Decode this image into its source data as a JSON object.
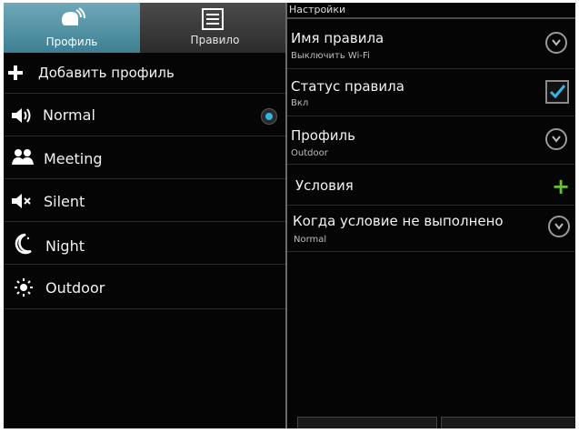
{
  "tabs": {
    "profile_label": "Профиль",
    "rule_label": "Правило"
  },
  "profiles": {
    "add_label": "Добавить профиль",
    "items": [
      {
        "label": "Normal",
        "icon": "speaker-icon",
        "selected": true
      },
      {
        "label": "Meeting",
        "icon": "people-icon",
        "selected": false
      },
      {
        "label": "Silent",
        "icon": "mute-icon",
        "selected": false
      },
      {
        "label": "Night",
        "icon": "moon-icon",
        "selected": false
      },
      {
        "label": "Outdoor",
        "icon": "sun-icon",
        "selected": false
      }
    ]
  },
  "settings": {
    "header": "Настройки",
    "rule_name": {
      "title": "Имя правила",
      "value": "Выключить Wi-Fi"
    },
    "rule_status": {
      "title": "Статус правила",
      "value": "Вкл",
      "checked": true
    },
    "profile": {
      "title": "Профиль",
      "value": "Outdoor"
    },
    "conditions": {
      "title": "Условия"
    },
    "otherwise": {
      "title": "Когда условие не выполнено",
      "value": "Normal"
    }
  },
  "colors": {
    "accent": "#33b5e5",
    "active_tab": "#4f90a3",
    "add_green": "#67c23a"
  }
}
